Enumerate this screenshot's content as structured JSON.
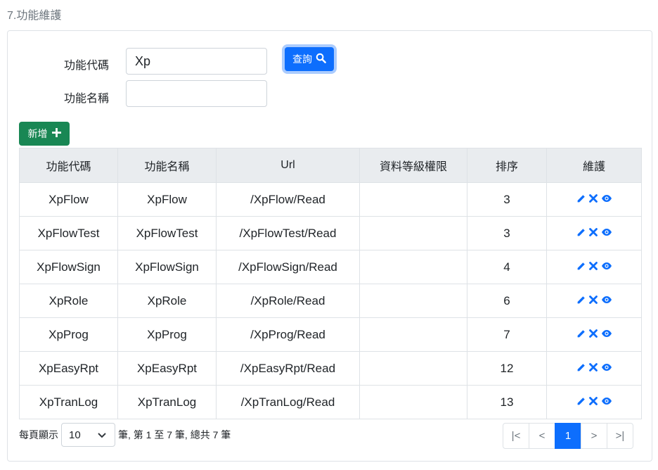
{
  "page_title": "7.功能維護",
  "search": {
    "code_label": "功能代碼",
    "code_value": "Xp",
    "name_label": "功能名稱",
    "name_value": "",
    "query_label": "查詢",
    "query_icon": "search-icon"
  },
  "add_button": {
    "label": "新增",
    "icon": "plus-icon"
  },
  "table": {
    "headers": [
      "功能代碼",
      "功能名稱",
      "Url",
      "資料等級權限",
      "排序",
      "維護"
    ],
    "rows": [
      {
        "code": "XpFlow",
        "name": "XpFlow",
        "url": "/XpFlow/Read",
        "level": "",
        "sort": "3"
      },
      {
        "code": "XpFlowTest",
        "name": "XpFlowTest",
        "url": "/XpFlowTest/Read",
        "level": "",
        "sort": "3"
      },
      {
        "code": "XpFlowSign",
        "name": "XpFlowSign",
        "url": "/XpFlowSign/Read",
        "level": "",
        "sort": "4"
      },
      {
        "code": "XpRole",
        "name": "XpRole",
        "url": "/XpRole/Read",
        "level": "",
        "sort": "6"
      },
      {
        "code": "XpProg",
        "name": "XpProg",
        "url": "/XpProg/Read",
        "level": "",
        "sort": "7"
      },
      {
        "code": "XpEasyRpt",
        "name": "XpEasyRpt",
        "url": "/XpEasyRpt/Read",
        "level": "",
        "sort": "12"
      },
      {
        "code": "XpTranLog",
        "name": "XpTranLog",
        "url": "/XpTranLog/Read",
        "level": "",
        "sort": "13"
      }
    ],
    "action_icons": [
      "pencil-icon",
      "delete-x-icon",
      "eye-icon"
    ]
  },
  "footer": {
    "per_page_label": "每頁顯示",
    "per_page_value": "10",
    "summary": "筆, 第 1 至 7 筆, 總共 7 筆"
  },
  "pagination": {
    "first": "|<",
    "prev": "<",
    "current": "1",
    "next": ">",
    "last": ">|"
  },
  "colors": {
    "primary": "#0d6efd",
    "success": "#198754",
    "header_bg": "#e9ecef",
    "border": "#dee2e6"
  }
}
